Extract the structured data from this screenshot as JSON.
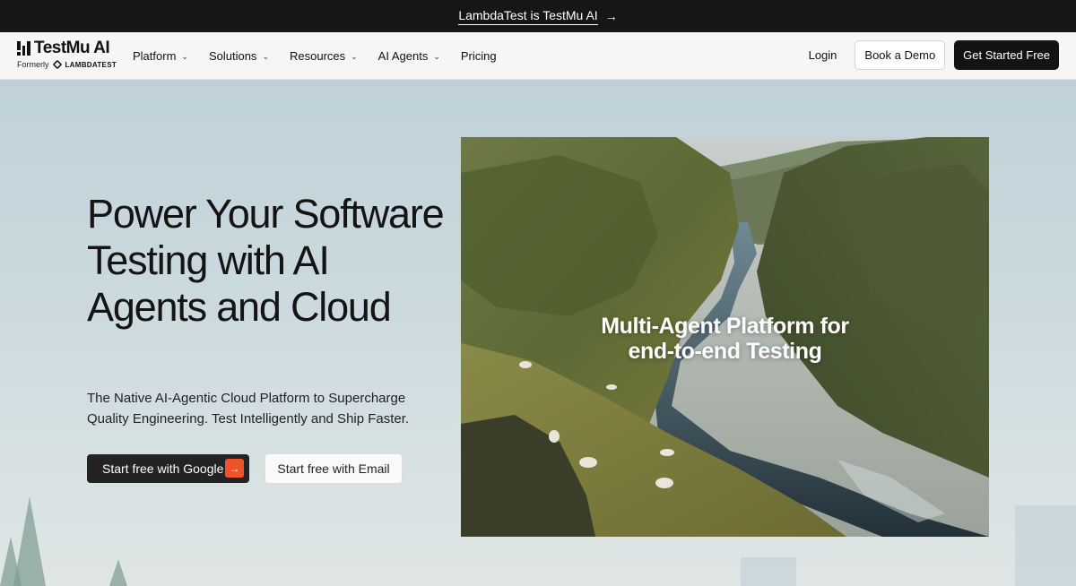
{
  "announcement": {
    "text": "LambdaTest is TestMu AI",
    "arrow_icon": "arrow-right-icon"
  },
  "logo": {
    "name": "TestMu AI",
    "formerly": "Formerly",
    "former_brand": "LAMBDATEST"
  },
  "nav": {
    "items": [
      {
        "label": "Platform",
        "has_dropdown": true
      },
      {
        "label": "Solutions",
        "has_dropdown": true
      },
      {
        "label": "Resources",
        "has_dropdown": true
      },
      {
        "label": "AI Agents",
        "has_dropdown": true
      },
      {
        "label": "Pricing",
        "has_dropdown": false
      }
    ],
    "login": "Login",
    "book_demo": "Book a Demo",
    "get_started": "Get Started Free"
  },
  "hero": {
    "title": "Power Your Software Testing with AI Agents and Cloud",
    "subtitle": "The Native AI-Agentic Cloud Platform to Supercharge Quality Engineering. Test Intelligently and Ship Faster.",
    "google_button": "Start free with Google",
    "email_button": "Start free with Email",
    "image_caption_line1": "Multi-Agent Platform for",
    "image_caption_line2": "end-to-end Testing"
  },
  "colors": {
    "accent_orange": "#f0522a",
    "dark": "#131313",
    "announcement_bg": "#161616"
  }
}
